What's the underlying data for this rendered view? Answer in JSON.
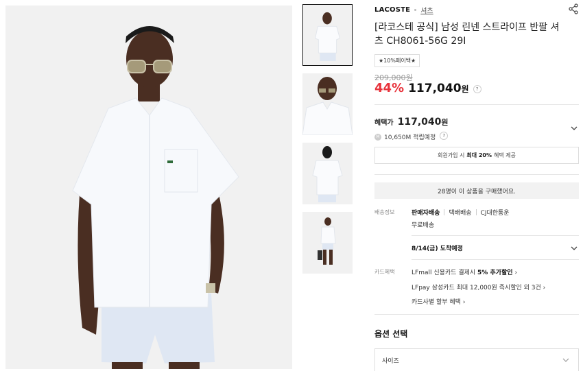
{
  "product": {
    "brand": "LACOSTE",
    "category": "셔츠",
    "title": "[라코스테 공식] 남성 린넨 스트라이프 반팔 셔츠 CH8061-56G 29I",
    "badge": "★10%페이백★",
    "original_price": "209,000원",
    "discount": "44%",
    "price": "117,040",
    "currency": "원",
    "help_mark": "?"
  },
  "benefit": {
    "label": "혜택가",
    "price": "117,040",
    "currency": "원",
    "points": "10,650M 적립예정",
    "points_icon": "M",
    "signup_pre": "회원가입 시",
    "signup_strong": "최대 20%",
    "signup_post": "혜택 제공"
  },
  "purchase_notice": "28명이 이 상품을 구매했어요.",
  "shipping": {
    "label": "배송정보",
    "seller": "판매자배송",
    "method": "택배배송",
    "carrier": "CJ대한통운",
    "fee": "무료배송",
    "arrival": "8/14(금) 도착예정"
  },
  "card": {
    "label": "카드혜택",
    "line1_pre": "LFmall 신용카드 결제시",
    "line1_strong": "5% 추가할인",
    "line2": "LFpay 삼성카드 최대 12,000원 즉시할인 외 3건",
    "line3": "카드사별 할부 혜택",
    "arrow": "›"
  },
  "options": {
    "title": "옵션 선택",
    "size_label": "사이즈"
  },
  "icons": {
    "share": "share-icon",
    "chevron": "chevron-down-icon"
  },
  "colors": {
    "discount": "#e8333c",
    "shirt": "#f3f6fa",
    "shorts": "#dfe7f3",
    "skin": "#4a2e22"
  }
}
